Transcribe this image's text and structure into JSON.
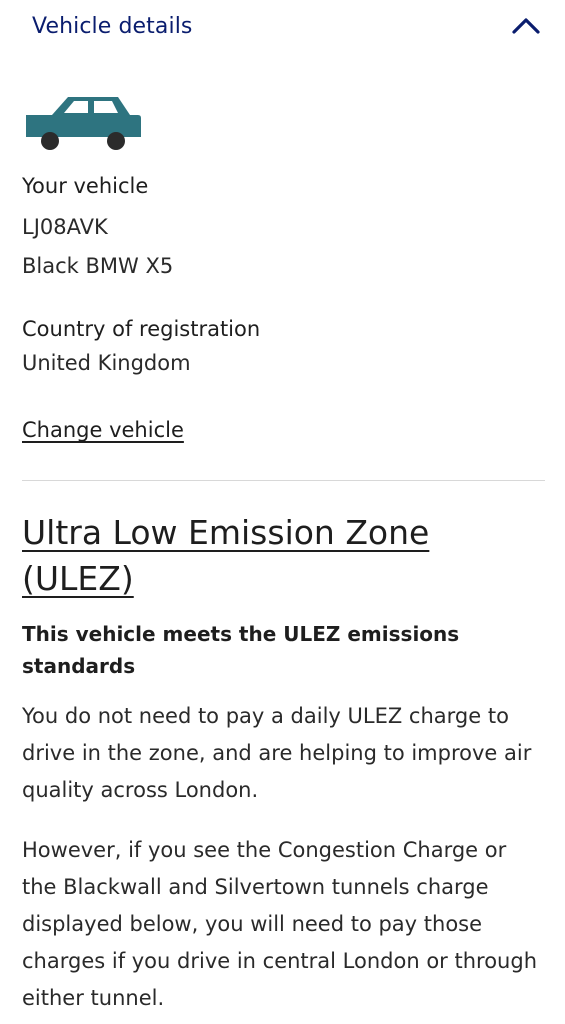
{
  "header": {
    "title": "Vehicle details",
    "toggle_icon": "chevron-up-icon",
    "accent": "#0a1d6e"
  },
  "vehicle": {
    "icon": "car-icon",
    "icon_color": "#2e7480",
    "label": "Your vehicle",
    "registration": "LJ08AVK",
    "description": "Black BMW X5",
    "country_label": "Country of registration",
    "country": "United Kingdom",
    "change_link": "Change vehicle"
  },
  "ulez": {
    "heading": "Ultra Low Emission Zone (ULEZ)",
    "status": "This vehicle meets the ULEZ emissions standards",
    "paragraph_1": "You do not need to pay a daily ULEZ charge to drive in the zone, and are helping to improve air quality across London.",
    "paragraph_2": "However, if you see the Congestion Charge or the Blackwall and Silvertown tunnels charge displayed below, you will need to pay those charges if you drive in central London or through either tunnel."
  }
}
